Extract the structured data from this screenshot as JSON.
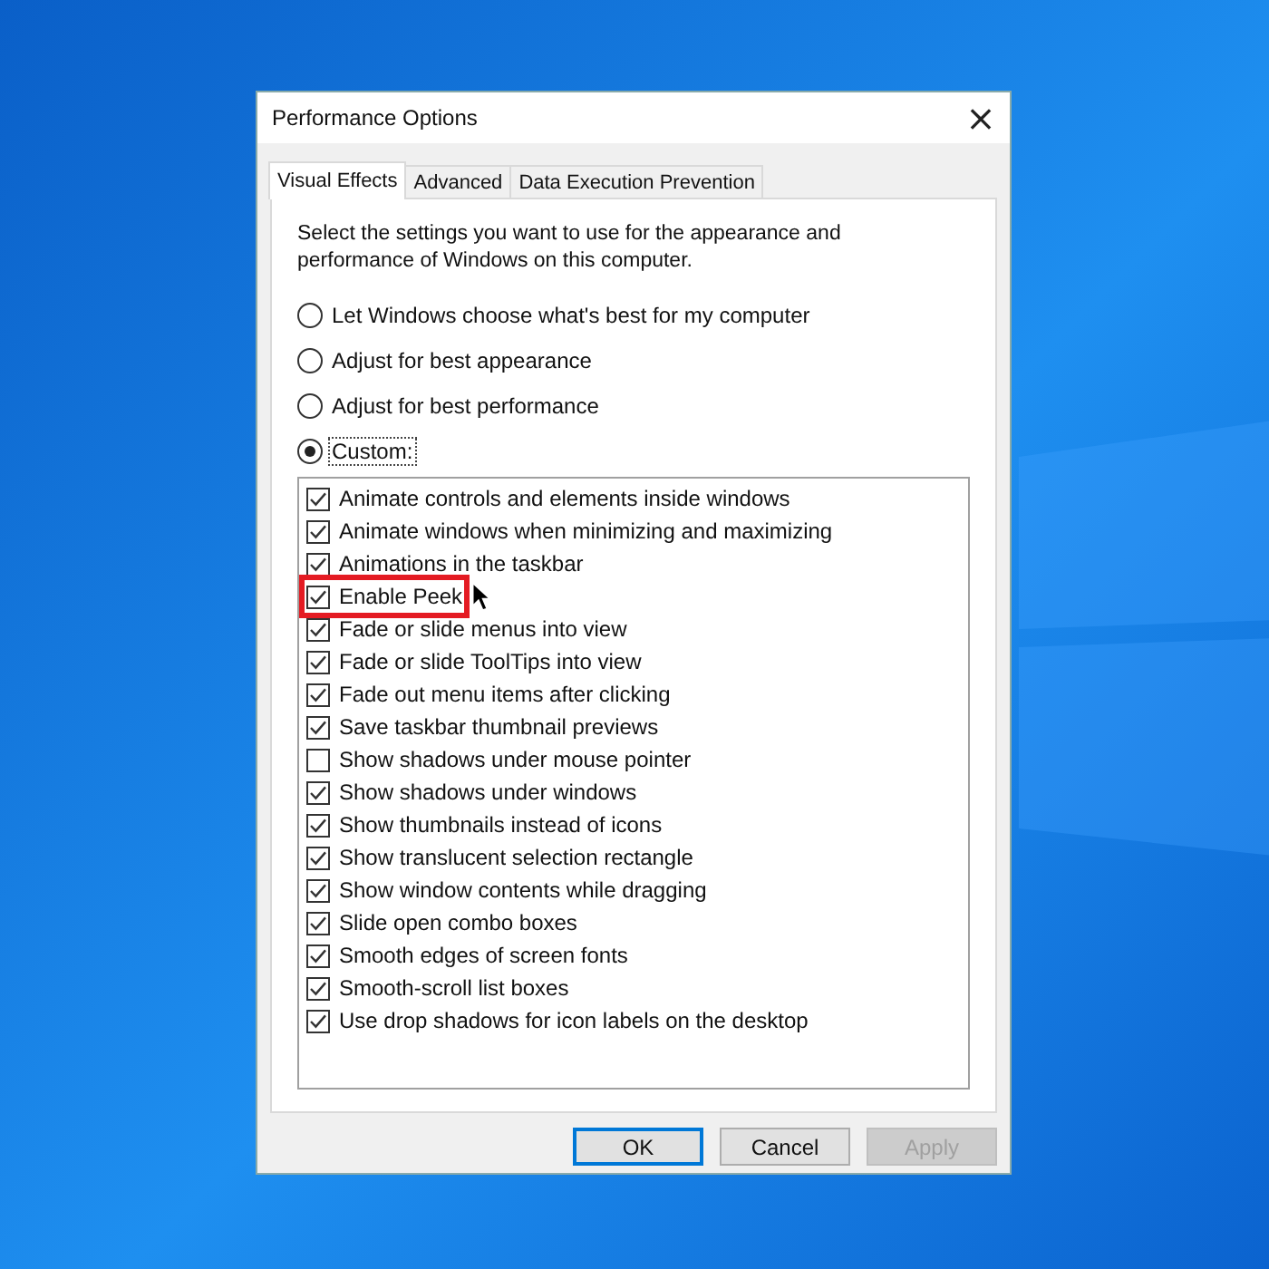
{
  "window": {
    "title": "Performance Options",
    "close": "×"
  },
  "tabs": [
    {
      "label": "Visual Effects",
      "selected": true
    },
    {
      "label": "Advanced",
      "selected": false
    },
    {
      "label": "Data Execution Prevention",
      "selected": false
    }
  ],
  "description": "Select the settings you want to use for the appearance and performance of Windows on this computer.",
  "options": [
    {
      "label": "Let Windows choose what's best for my computer",
      "selected": false,
      "focused": false
    },
    {
      "label": "Adjust for best appearance",
      "selected": false,
      "focused": false
    },
    {
      "label": "Adjust for best performance",
      "selected": false,
      "focused": false
    },
    {
      "label": "Custom:",
      "selected": true,
      "focused": true
    }
  ],
  "effects": [
    {
      "label": "Animate controls and elements inside windows",
      "checked": true,
      "highlighted": false
    },
    {
      "label": "Animate windows when minimizing and maximizing",
      "checked": true,
      "highlighted": false
    },
    {
      "label": "Animations in the taskbar",
      "checked": true,
      "highlighted": false
    },
    {
      "label": "Enable Peek",
      "checked": true,
      "highlighted": true
    },
    {
      "label": "Fade or slide menus into view",
      "checked": true,
      "highlighted": false
    },
    {
      "label": "Fade or slide ToolTips into view",
      "checked": true,
      "highlighted": false
    },
    {
      "label": "Fade out menu items after clicking",
      "checked": true,
      "highlighted": false
    },
    {
      "label": "Save taskbar thumbnail previews",
      "checked": true,
      "highlighted": false
    },
    {
      "label": "Show shadows under mouse pointer",
      "checked": false,
      "highlighted": false
    },
    {
      "label": "Show shadows under windows",
      "checked": true,
      "highlighted": false
    },
    {
      "label": "Show thumbnails instead of icons",
      "checked": true,
      "highlighted": false
    },
    {
      "label": "Show translucent selection rectangle",
      "checked": true,
      "highlighted": false
    },
    {
      "label": "Show window contents while dragging",
      "checked": true,
      "highlighted": false
    },
    {
      "label": "Slide open combo boxes",
      "checked": true,
      "highlighted": false
    },
    {
      "label": "Smooth edges of screen fonts",
      "checked": true,
      "highlighted": false
    },
    {
      "label": "Smooth-scroll list boxes",
      "checked": true,
      "highlighted": false
    },
    {
      "label": "Use drop shadows for icon labels on the desktop",
      "checked": true,
      "highlighted": false
    }
  ],
  "buttons": [
    {
      "label": "OK",
      "default": true,
      "disabled": false
    },
    {
      "label": "Cancel",
      "default": false,
      "disabled": false
    },
    {
      "label": "Apply",
      "default": false,
      "disabled": true
    }
  ]
}
